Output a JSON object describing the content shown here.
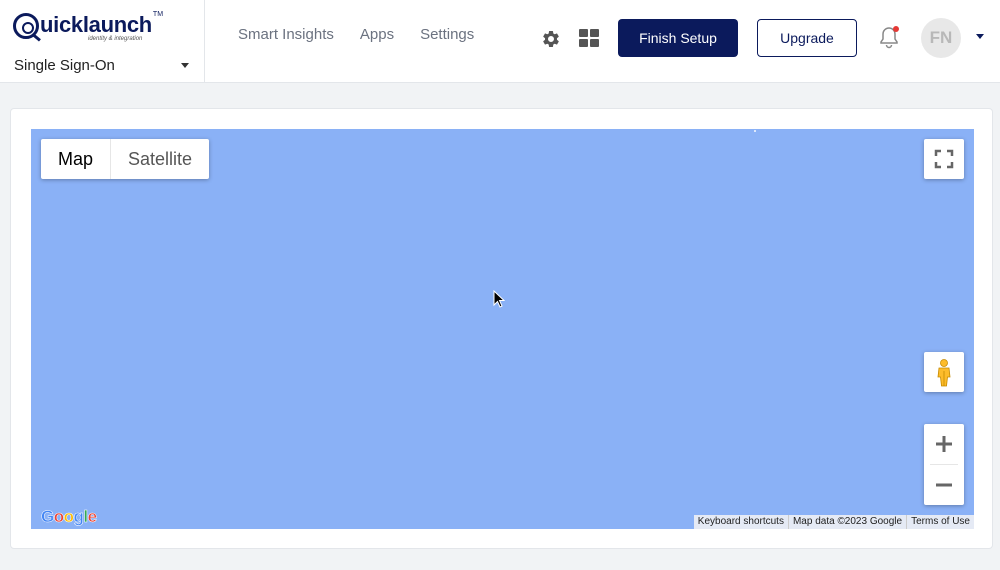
{
  "brand": {
    "name": "uicklaunch",
    "tm": "TM",
    "tagline": "identity & integration"
  },
  "module_selector": {
    "label": "Single Sign-On"
  },
  "nav": [
    {
      "label": "Smart Insights"
    },
    {
      "label": "Apps"
    },
    {
      "label": "Settings"
    }
  ],
  "header_actions": {
    "finish_setup": "Finish Setup",
    "upgrade": "Upgrade",
    "avatar_initials": "FN",
    "icons": [
      "gear-icon",
      "grid-icon",
      "bell-icon"
    ],
    "notification_dot_color": "#e53935"
  },
  "map": {
    "types": [
      {
        "label": "Map",
        "active": true
      },
      {
        "label": "Satellite",
        "active": false
      }
    ],
    "attribution": [
      "Keyboard shortcuts",
      "Map data ©2023 Google",
      "Terms of Use"
    ],
    "water_color": "#8ab1f6"
  },
  "colors": {
    "brand_navy": "#0b1a5c",
    "nav_text": "#6b7280",
    "page_bg": "#f1f3f5"
  }
}
